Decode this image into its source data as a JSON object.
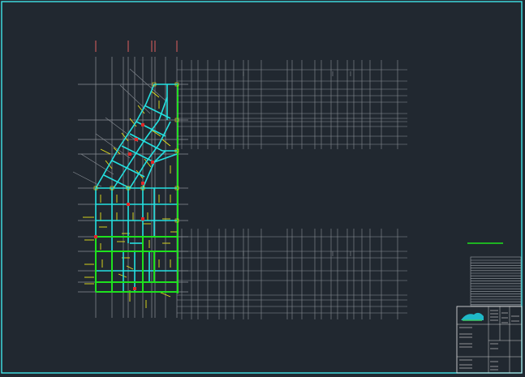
{
  "drawing": {
    "background": "#212830",
    "frame_color": "#3fe3e8",
    "grid_color": "#8a8f96",
    "structure_color": "#24e0e0",
    "wall_color": "#1ee11e",
    "rebar_color": "#e7e21a",
    "axis_mark_color": "#e06060",
    "column_mark_color": "#e02828"
  },
  "title_block": {
    "project_name": "",
    "drawing_title": "",
    "drawing_number": ""
  }
}
